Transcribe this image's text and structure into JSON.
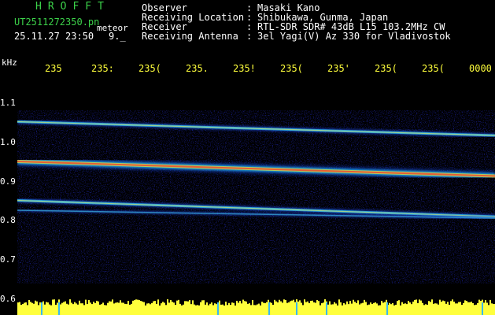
{
  "header": {
    "brand": "HROFFT",
    "filename": "UT2511272350.pn",
    "meteor_label": "meteor",
    "datetime": "25.11.27 23:50",
    "count": "9._",
    "info": [
      {
        "label": "Observer",
        "value": "Masaki Kano"
      },
      {
        "label": "Receiving Location",
        "value": "Shibukawa, Gunma, Japan"
      },
      {
        "label": "Receiver",
        "value": "RTL-SDR SDR# 43dB L15 103.2MHz CW"
      },
      {
        "label": "Receiving Antenna",
        "value": "3el Yagi(V) Az 330 for Vladivostok"
      }
    ],
    "separator": ":"
  },
  "axis": {
    "unit": "kHz",
    "y_ticks": [
      "1.1",
      "1.0",
      "0.9",
      "0.8",
      "0.7",
      "0.6"
    ],
    "time_ticks": [
      "235",
      "235:",
      "235(",
      "235.",
      "235!",
      "235(",
      "235'",
      "235(",
      "235(",
      "0000"
    ]
  },
  "colors": {
    "background": "#000000",
    "header_green": "#3cd24a",
    "time_yellow": "#ffff3c",
    "noise_blue": "#0a0aa0",
    "signal_peak": "#ff2010"
  },
  "spectrogram": {
    "traces": [
      {
        "name": "upper",
        "start_khz": 1.053,
        "end_khz": 1.018
      },
      {
        "name": "main",
        "start_khz": 0.952,
        "end_khz": 0.915
      },
      {
        "name": "lower",
        "start_khz": 0.853,
        "end_khz": 0.812
      },
      {
        "name": "lower-secondary",
        "start_khz": 0.828,
        "end_khz": 0.808
      }
    ]
  }
}
